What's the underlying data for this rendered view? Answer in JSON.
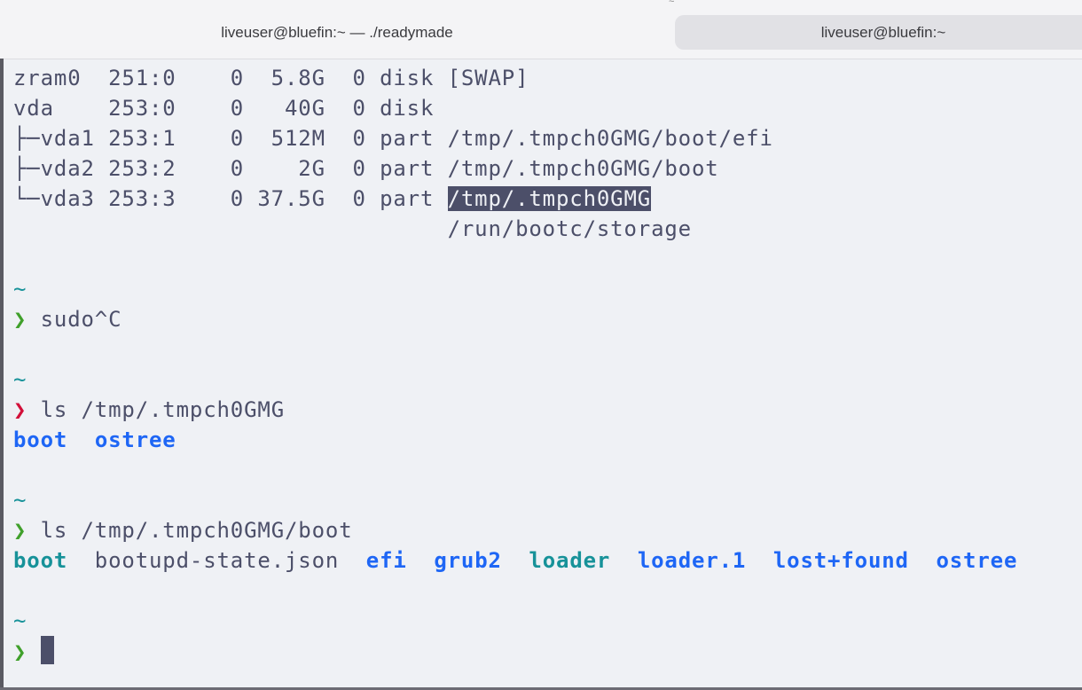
{
  "window": {
    "tabs": [
      {
        "label": "liveuser@bluefin:~ — ./readymade",
        "active": false
      },
      {
        "label": "liveuser@bluefin:~",
        "active": true
      }
    ],
    "top_marker": "~"
  },
  "terminal": {
    "lines": [
      [
        [
          "zram0  251:0    0  5.8G  0 disk [SWAP]",
          "text"
        ]
      ],
      [
        [
          "vda    253:0    0   40G  0 disk",
          "text"
        ]
      ],
      [
        [
          "├─vda1 253:1    0  512M  0 part /tmp/.tmpch0GMG/boot/efi",
          "text"
        ]
      ],
      [
        [
          "├─vda2 253:2    0    2G  0 part /tmp/.tmpch0GMG/boot",
          "text"
        ]
      ],
      [
        [
          "└─vda3 253:3    0 37.5G  0 part ",
          "text"
        ],
        [
          "/tmp/.tmpch0GMG",
          "sel"
        ]
      ],
      [
        [
          "                                /run/bootc/storage",
          "text"
        ]
      ],
      [],
      [
        [
          "~",
          "teal"
        ]
      ],
      [
        [
          "❯",
          "green"
        ],
        [
          " sudo^C",
          "text"
        ]
      ],
      [],
      [
        [
          "~",
          "teal"
        ]
      ],
      [
        [
          "❯",
          "red"
        ],
        [
          " ls /tmp/.tmpch0GMG",
          "text"
        ]
      ],
      [
        [
          "boot",
          "blue bold"
        ],
        [
          "  ",
          "text"
        ],
        [
          "ostree",
          "blue bold"
        ]
      ],
      [],
      [
        [
          "~",
          "teal"
        ]
      ],
      [
        [
          "❯",
          "green"
        ],
        [
          " ls /tmp/.tmpch0GMG/boot",
          "text"
        ]
      ],
      [
        [
          "boot",
          "teal bold"
        ],
        [
          "  bootupd-state.json  ",
          "text"
        ],
        [
          "efi",
          "blue bold"
        ],
        [
          "  ",
          "text"
        ],
        [
          "grub2",
          "blue bold"
        ],
        [
          "  ",
          "text"
        ],
        [
          "loader",
          "teal bold"
        ],
        [
          "  ",
          "text"
        ],
        [
          "loader.1",
          "blue bold"
        ],
        [
          "  ",
          "text"
        ],
        [
          "lost+found",
          "blue bold"
        ],
        [
          "  ",
          "text"
        ],
        [
          "ostree",
          "blue bold"
        ]
      ],
      [],
      [
        [
          "~",
          "teal"
        ]
      ],
      [
        [
          "❯",
          "green"
        ],
        [
          " ",
          "text"
        ]
      ]
    ],
    "cursor_line": 19
  },
  "colors": {
    "background": "#eff1f5",
    "text": "#4c4f69",
    "green": "#40a02b",
    "red": "#d20f39",
    "blue": "#1e66f5",
    "teal": "#179299"
  }
}
